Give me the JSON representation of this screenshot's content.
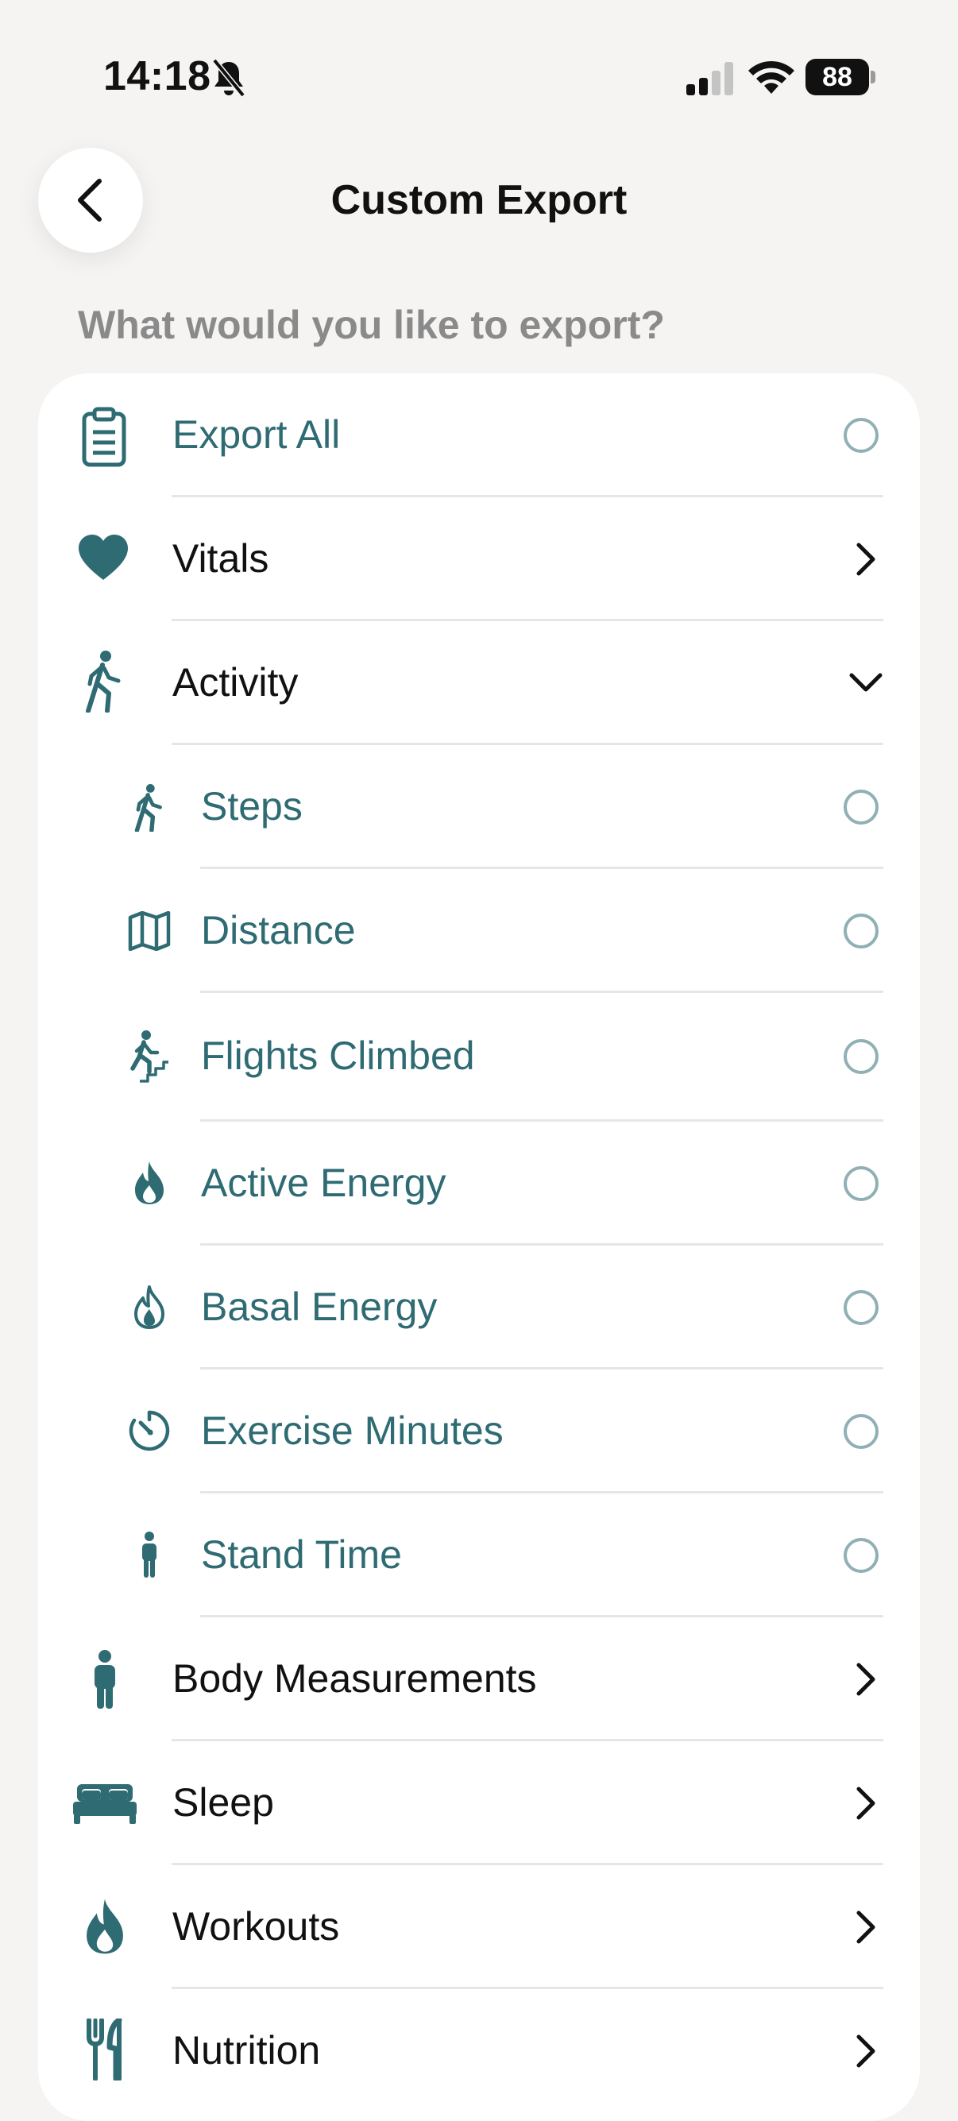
{
  "status": {
    "time": "14:18",
    "battery": "88"
  },
  "header": {
    "title": "Custom Export"
  },
  "prompt": "What would you like to export?",
  "colors": {
    "teal": "#2e6b73",
    "radio_border": "#8fb0b4",
    "background": "#f5f4f2"
  },
  "items": [
    {
      "label": "Export All",
      "icon": "clipboard-icon",
      "control": "radio",
      "level": 0
    },
    {
      "label": "Vitals",
      "icon": "heart-icon",
      "control": "chevron-right",
      "level": 0
    },
    {
      "label": "Activity",
      "icon": "walking-icon",
      "control": "chevron-down",
      "level": 0
    },
    {
      "label": "Steps",
      "icon": "walking-icon",
      "control": "radio",
      "level": 1
    },
    {
      "label": "Distance",
      "icon": "map-icon",
      "control": "radio",
      "level": 1
    },
    {
      "label": "Flights Climbed",
      "icon": "stairs-icon",
      "control": "radio",
      "level": 1
    },
    {
      "label": "Active Energy",
      "icon": "flame-icon",
      "control": "radio",
      "level": 1
    },
    {
      "label": "Basal Energy",
      "icon": "flame-outline-icon",
      "control": "radio",
      "level": 1
    },
    {
      "label": "Exercise Minutes",
      "icon": "timer-icon",
      "control": "radio",
      "level": 1
    },
    {
      "label": "Stand Time",
      "icon": "standing-person-icon",
      "control": "radio",
      "level": 1
    },
    {
      "label": "Body Measurements",
      "icon": "person-icon",
      "control": "chevron-right",
      "level": 0
    },
    {
      "label": "Sleep",
      "icon": "bed-icon",
      "control": "chevron-right",
      "level": 0
    },
    {
      "label": "Workouts",
      "icon": "flame-icon",
      "control": "chevron-right",
      "level": 0
    },
    {
      "label": "Nutrition",
      "icon": "fork-knife-icon",
      "control": "chevron-right",
      "level": 0
    }
  ]
}
